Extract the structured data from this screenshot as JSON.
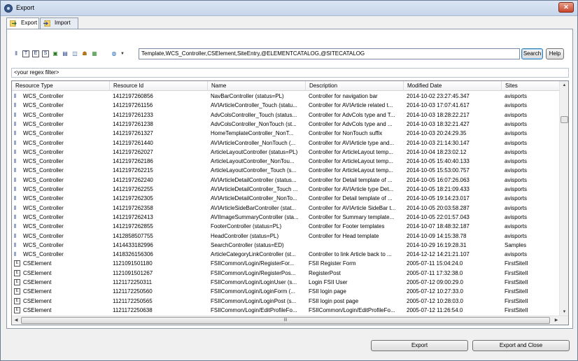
{
  "window": {
    "title": "Export",
    "close_glyph": "✕"
  },
  "tabs": [
    {
      "label": "Export",
      "icon": "export-icon",
      "active": true
    },
    {
      "label": "Import",
      "icon": "import-icon",
      "active": false
    }
  ],
  "toolbar": {
    "icons": [
      "wcs-controller-icon",
      "template-icon",
      "element-icon",
      "site-entry-icon",
      "attribute-icon",
      "page-icon",
      "flex-family-icon",
      "user-icon",
      "asset-icon",
      "globe-icon"
    ],
    "query_value": "Template,WCS_Controller,CSElement,SiteEntry,@ELEMENTCATALOG,@SITECATALOG",
    "search_label": "Search",
    "help_label": "Help"
  },
  "filter": {
    "placeholder": "<your regex filter>"
  },
  "table": {
    "columns": [
      "Resource Type",
      "Resource Id",
      "Name",
      "Description",
      "Modified Date",
      "Sites"
    ],
    "rows": [
      [
        "WCS_Controller",
        "1412197260856",
        "NavBarController (status=PL)",
        "Controller for navigation bar",
        "2014-10-02 23:27:45.347",
        "avisports"
      ],
      [
        "WCS_Controller",
        "1412197261156",
        "AVIArticleController_Touch (statu...",
        "Controller for AVIArticle related t...",
        "2014-10-03 17:07:41.617",
        "avisports"
      ],
      [
        "WCS_Controller",
        "1412197261233",
        "AdvColsController_Touch (status...",
        "Controller for AdvCols type and T...",
        "2014-10-03 18:28:22.217",
        "avisports"
      ],
      [
        "WCS_Controller",
        "1412197261238",
        "AdvColsController_NonTouch (st...",
        "Controller for AdvCols type and ...",
        "2014-10-03 18:32:21.427",
        "avisports"
      ],
      [
        "WCS_Controller",
        "1412197261327",
        "HomeTemplateController_NonT...",
        "Controller for NonTouch suffix",
        "2014-10-03 20:24:29.35",
        "avisports"
      ],
      [
        "WCS_Controller",
        "1412197261440",
        "AVIArticleController_NonTouch (...",
        "Controller for AVIArticle type and...",
        "2014-10-03 21:14:30.147",
        "avisports"
      ],
      [
        "WCS_Controller",
        "1412197262027",
        "ArticleLayoutController (status=PL)",
        "Controller for ArticleLayout temp...",
        "2014-10-04 18:23:02.12",
        "avisports"
      ],
      [
        "WCS_Controller",
        "1412197262186",
        "ArticleLayoutController_NonTou...",
        "Controller for ArticleLayout temp...",
        "2014-10-05 15:40:40.133",
        "avisports"
      ],
      [
        "WCS_Controller",
        "1412197262215",
        "ArticleLayoutController_Touch (s...",
        "Controller for ArticleLayout temp...",
        "2014-10-05 15:53:00.757",
        "avisports"
      ],
      [
        "WCS_Controller",
        "1412197262240",
        "AVIArticleDetailController (status...",
        "Controller for Detail template of ...",
        "2014-10-05 16:07:26.063",
        "avisports"
      ],
      [
        "WCS_Controller",
        "1412197262255",
        "AVIArticleDetailController_Touch ...",
        "Controller for AVIArticle type  Det...",
        "2014-10-05 18:21:09.433",
        "avisports"
      ],
      [
        "WCS_Controller",
        "1412197262305",
        "AVIArticleDetailController_NonTo...",
        "Controller for Detail template of ...",
        "2014-10-05 19:14:23.017",
        "avisports"
      ],
      [
        "WCS_Controller",
        "1412197262358",
        "AVIArticleSideBarController (stat...",
        "Controller for AVIArticle SideBar t...",
        "2014-10-05 20:03:58.287",
        "avisports"
      ],
      [
        "WCS_Controller",
        "1412197262413",
        "AVIImageSummaryController (sta...",
        "Controller for Summary template...",
        "2014-10-05 22:01:57.043",
        "avisports"
      ],
      [
        "WCS_Controller",
        "1412197262855",
        "FooterController (status=PL)",
        "Controller for Footer templates",
        "2014-10-07 18:48:32.187",
        "avisports"
      ],
      [
        "WCS_Controller",
        "1412858507755",
        "HeadController (status=PL)",
        "Controller for Head template",
        "2014-10-09 14:15:38.78",
        "avisports"
      ],
      [
        "WCS_Controller",
        "1414433182996",
        "SearchController (status=ED)",
        "",
        "2014-10-29 16:19:28.31",
        "Samples"
      ],
      [
        "WCS_Controller",
        "1418326156306",
        "ArticleCategoryLinkController (st...",
        "Controller to link Article back to ...",
        "2014-12-12 14:21:21.107",
        "avisports"
      ],
      [
        "CSElement",
        "1121091501180",
        "FSIICommon/Login/RegisterFor...",
        "FSII Register Form",
        "2005-07-11 15:04:24.0",
        "FirstSiteII"
      ],
      [
        "CSElement",
        "1121091501267",
        "FSIICommon/Login/RegisterPos...",
        "RegisterPost",
        "2005-07-11 17:32:38.0",
        "FirstSiteII"
      ],
      [
        "CSElement",
        "1121172250311",
        "FSIICommon/Login/LoginUser (s...",
        "Login FSII User",
        "2005-07-12 09:00:29.0",
        "FirstSiteII"
      ],
      [
        "CSElement",
        "1121172250560",
        "FSIICommon/Login/LoginForm (...",
        "FSII login page",
        "2005-07-12 10:27:33.0",
        "FirstSiteII"
      ],
      [
        "CSElement",
        "1121172250565",
        "FSIICommon/Login/LoginPost (s...",
        "FSII login post page",
        "2005-07-12 10:28:03.0",
        "FirstSiteII"
      ],
      [
        "CSElement",
        "1121172250638",
        "FSIICommon/Login/EditProfileFo...",
        "FSIICommon/Login/EditProfileFo...",
        "2005-07-12 11:26:54.0",
        "FirstSiteII"
      ]
    ]
  },
  "scrollbar": {
    "h_grip": "III"
  },
  "footer": {
    "export_label": "Export",
    "export_close_label": "Export and Close"
  }
}
